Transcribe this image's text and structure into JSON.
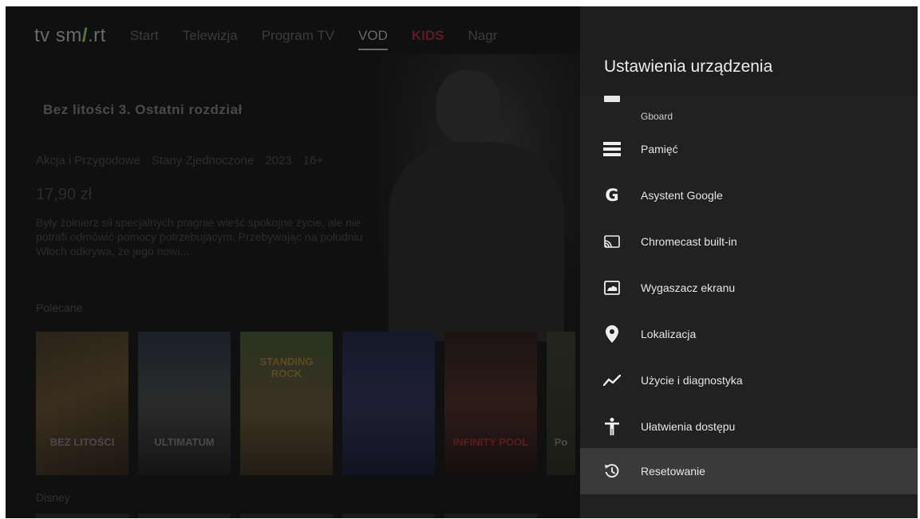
{
  "background_app": {
    "logo": {
      "prefix": "tv sm",
      "slash": "/",
      "suffix": ".rt"
    },
    "nav": [
      {
        "label": "Start",
        "active": false
      },
      {
        "label": "Telewizja",
        "active": false
      },
      {
        "label": "Program TV",
        "active": false
      },
      {
        "label": "VOD",
        "active": true
      },
      {
        "label": "KIDS",
        "active": false
      },
      {
        "label": "Nagr",
        "active": false
      }
    ],
    "movie": {
      "title": "Bez litości 3. Ostatni rozdział",
      "meta": [
        "Akcja i Przygodowe",
        "Stany Zjednoczone",
        "2023",
        "16+"
      ],
      "price": "17,90 zł",
      "description": "Były żołnierz sił specjalnych pragnie wieść spokojne życie, ale nie potrafi odmówić pomocy potrzebującym. Przebywając na południu Włoch odkrywa, że jego nowi..."
    },
    "section_recommended": "Polecane",
    "section_second": "Disney",
    "posters": [
      {
        "text": "BEZ LITOŚCI"
      },
      {
        "text": "ULTIMATUM"
      },
      {
        "text": "STANDING ROCK"
      },
      {
        "text": ""
      },
      {
        "text": "INFINITY POOL"
      },
      {
        "text": "Po"
      }
    ]
  },
  "panel": {
    "title": "Ustawienia urządzenia",
    "partial_item": {
      "label": "Gboard",
      "icon": "keyboard-icon"
    },
    "items": [
      {
        "label": "Pamięć",
        "icon": "storage-icon"
      },
      {
        "label": "Asystent Google",
        "icon": "google-g-icon",
        "glyph": "G"
      },
      {
        "label": "Chromecast built-in",
        "icon": "cast-icon"
      },
      {
        "label": "Wygaszacz ekranu",
        "icon": "screensaver-icon"
      },
      {
        "label": "Lokalizacja",
        "icon": "location-pin-icon"
      },
      {
        "label": "Użycie i diagnostyka",
        "icon": "diagnostics-trend-icon"
      },
      {
        "label": "Ułatwienia dostępu",
        "icon": "accessibility-icon"
      },
      {
        "label": "Resetowanie",
        "icon": "reset-history-icon",
        "selected": true
      }
    ]
  },
  "colors": {
    "panel_bg": "#212121",
    "selected_bg": "#3a3a3a",
    "text": "#e6e6e6",
    "kids_accent": "#5a1d24",
    "logo_accent": "#5b7a2a"
  }
}
